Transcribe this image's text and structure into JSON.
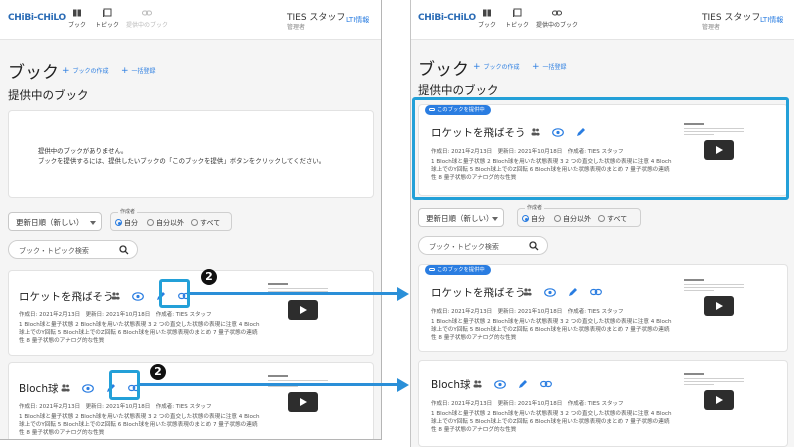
{
  "app": {
    "logo": "CHiBi-CHiLO",
    "nav": {
      "book": "ブック",
      "topic": "トピック",
      "shared": "提供中のブック"
    },
    "user_name": "TIES スタッフ",
    "user_role": "管理者",
    "lti": "LTI情報"
  },
  "page": {
    "title": "ブック",
    "create_book": "ブックの作成",
    "bulk_register": "一括登録",
    "shared_heading": "提供中のブック"
  },
  "empty_state": {
    "line1": "提供中のブックがありません。",
    "line2": "ブックを提供するには、提供したいブックの「このブックを提供」ボタンをクリックしてください。"
  },
  "filters": {
    "sort_value": "更新日順（新しい）",
    "author_label": "作成者",
    "author_options": [
      "自分",
      "自分以外",
      "すべて"
    ],
    "author_selected": "自分",
    "search_placeholder": "ブック・トピック検索"
  },
  "shared_badge": "このブックを提供中",
  "books": [
    {
      "title": "ロケットを飛ばそう",
      "dates": "作成日: 2021年2月13日　更新日: 2021年10月18日　作成者: TIES スタッフ",
      "desc": "1 Bloch球と量子状態 2 Bloch球を用いた状態表現 3 2 つの直交した状態の表現に注意 4 Bloch球上でのY回転 5 Bloch球上でのZ回転 6 Bloch球を用いた状態表現のまとめ 7 量子状態の連続性 8 量子状態のアナログ的な性質"
    },
    {
      "title": "Bloch球",
      "dates": "作成日: 2021年2月13日　更新日: 2021年10月18日　作成者: TIES スタッフ",
      "desc": "1 Bloch球と量子状態 2 Bloch球を用いた状態表現 3 2 つの直交した状態の表現に注意 4 Bloch球上でのY回転 5 Bloch球上でのZ回転 6 Bloch球を用いた状態表現のまとめ 7 量子状態の連続性 8 量子状態のアナログ的な性質"
    }
  ],
  "annotation_marker": "2",
  "colors": {
    "accent": "#2a7de1",
    "highlight": "#23a0d8",
    "arrow": "#2a8fd8"
  }
}
